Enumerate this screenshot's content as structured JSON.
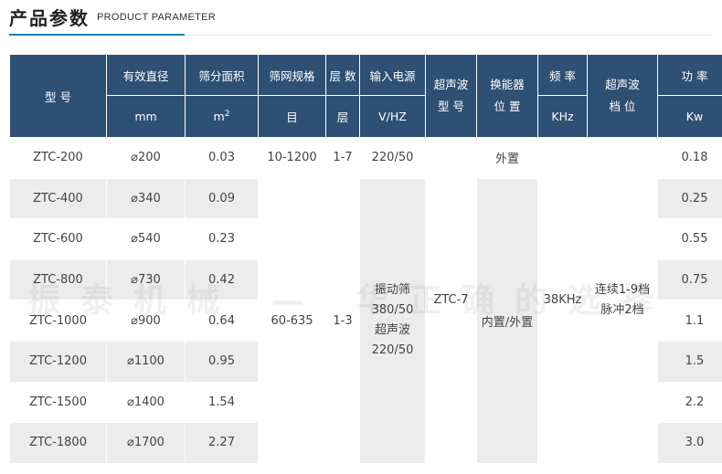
{
  "header": {
    "title_cn": "产品参数",
    "title_en": "PRODUCT PARAMETER"
  },
  "table": {
    "head": {
      "model": "型 号",
      "diameter": "有效直径",
      "diameter_unit": "mm",
      "area": "筛分面积",
      "area_unit": "m",
      "area_unit_sup": "2",
      "mesh": "筛网规格",
      "mesh_unit": "目",
      "layers": "层 数",
      "layers_unit": "层",
      "power_input": "输入电源",
      "power_input_unit": "V/HZ",
      "ultra_model": "超声波\n型 号",
      "transducer": "换能器\n位 置",
      "frequency": "频 率",
      "frequency_unit": "KHz",
      "gear": "超声波\n档 位",
      "power": "功 率",
      "power_unit": "Kw"
    },
    "rows": [
      {
        "model": "ZTC-200",
        "diameter": "⌀200",
        "area": "0.03",
        "power": "0.18"
      },
      {
        "model": "ZTC-400",
        "diameter": "⌀340",
        "area": "0.09",
        "power": "0.25"
      },
      {
        "model": "ZTC-600",
        "diameter": "⌀540",
        "area": "0.23",
        "power": "0.55"
      },
      {
        "model": "ZTC-800",
        "diameter": "⌀730",
        "area": "0.42",
        "power": "0.75"
      },
      {
        "model": "ZTC-1000",
        "diameter": "⌀900",
        "area": "0.64",
        "power": "1.1"
      },
      {
        "model": "ZTC-1200",
        "diameter": "⌀1100",
        "area": "0.95",
        "power": "1.5"
      },
      {
        "model": "ZTC-1500",
        "diameter": "⌀1400",
        "area": "1.54",
        "power": "2.2"
      },
      {
        "model": "ZTC-1800",
        "diameter": "⌀1700",
        "area": "2.27",
        "power": "3.0"
      }
    ],
    "first_row": {
      "mesh": "10-1200",
      "layers": "1-7",
      "power_input": "220/50",
      "transducer": "外置"
    },
    "merged": {
      "mesh": "60-635",
      "layers": "1-3",
      "power_input": "振动筛\n380/50\n超声波\n220/50",
      "ultra_model": "ZTC-7",
      "transducer": "内置/外置",
      "frequency": "38KHz",
      "gear": "连续1-9档\n脉冲2档"
    }
  },
  "watermark": "振泰机械 — 华正确的选择"
}
